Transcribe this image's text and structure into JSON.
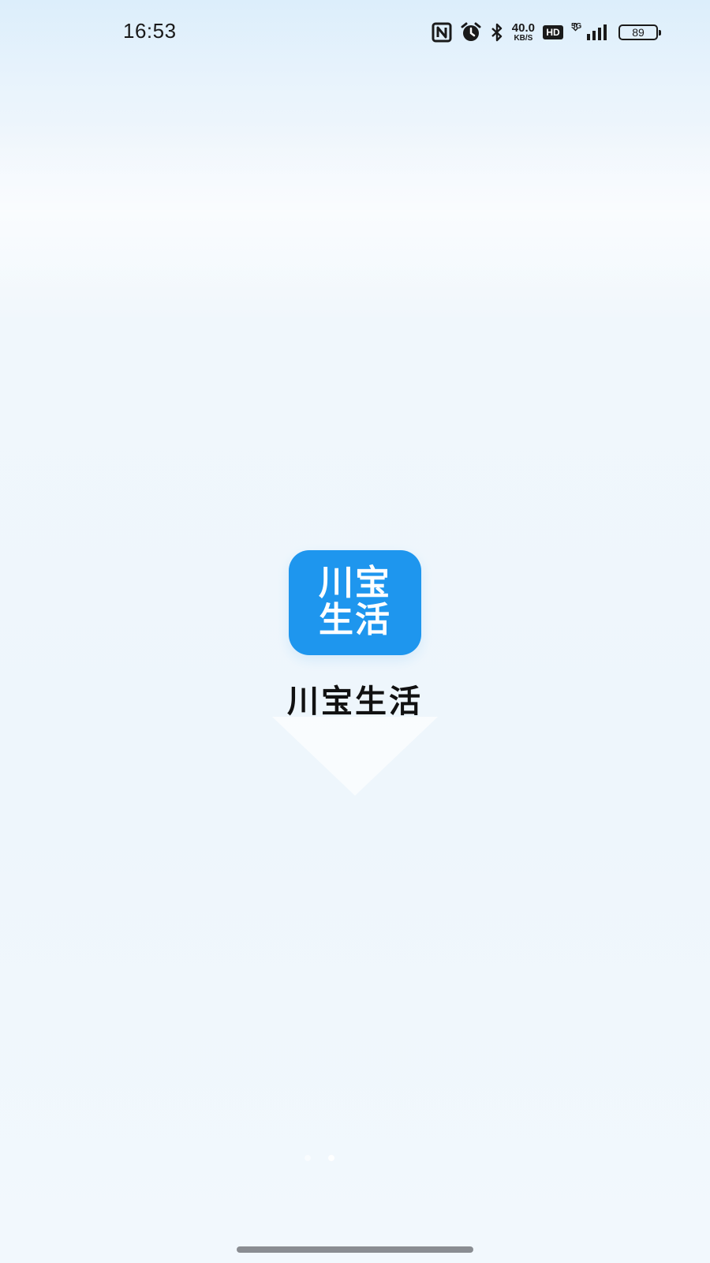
{
  "status_bar": {
    "time": "16:53",
    "network_speed_value": "40.0",
    "network_speed_unit": "KB/S",
    "hd_label": "HD",
    "network_type": "5G",
    "battery_level": "89",
    "icons": [
      "nfc-icon",
      "alarm-icon",
      "bluetooth-icon",
      "hd-icon",
      "signal-icon",
      "battery-icon"
    ]
  },
  "splash": {
    "icon_text": "川宝\n生活",
    "app_name": "川宝生活",
    "brand_color": "#1e96ee"
  },
  "colors": {
    "background": "#eef6fc",
    "text": "#111111"
  }
}
